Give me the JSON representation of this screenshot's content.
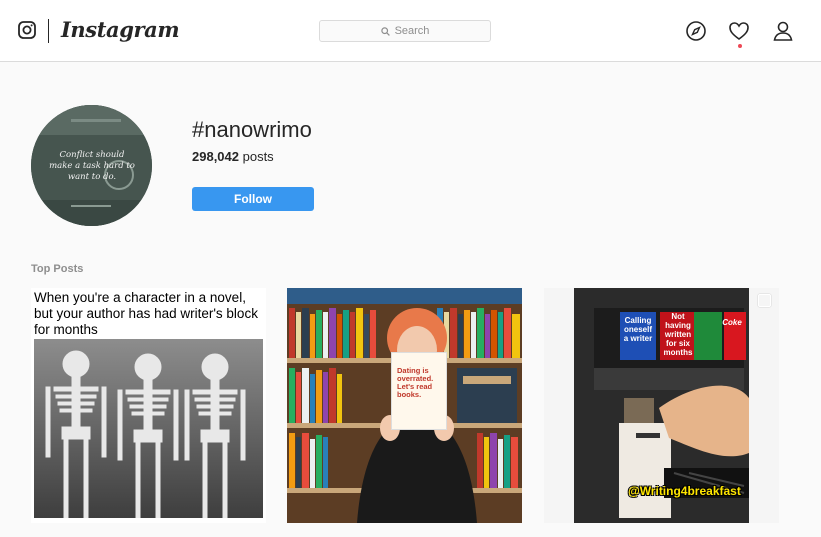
{
  "nav": {
    "brand": "Instagram",
    "search_placeholder": "Search",
    "icons": [
      "instagram-glyph-icon",
      "search-icon",
      "explore-compass-icon",
      "activity-heart-icon",
      "profile-person-icon"
    ]
  },
  "header": {
    "hashtag": "#nanowrimo",
    "post_count": "298,042",
    "post_count_suffix": " posts",
    "follow_label": "Follow",
    "avatar_text": "Conflict should make a task hard to want to do."
  },
  "section": {
    "top_posts_label": "Top Posts"
  },
  "posts": [
    {
      "caption": "When you're a character in a novel, but your author has had writer's block for months"
    },
    {
      "sign_text": "Dating is overrated. Let's read books."
    },
    {
      "labels": [
        "Calling oneself a writer",
        "Not having written for six months",
        "",
        "Coke"
      ],
      "watermark": "@Writing4breakfast"
    }
  ],
  "colors": {
    "accent": "#3897f0",
    "notification": "#ed4956",
    "watermark": "#ffe600"
  }
}
